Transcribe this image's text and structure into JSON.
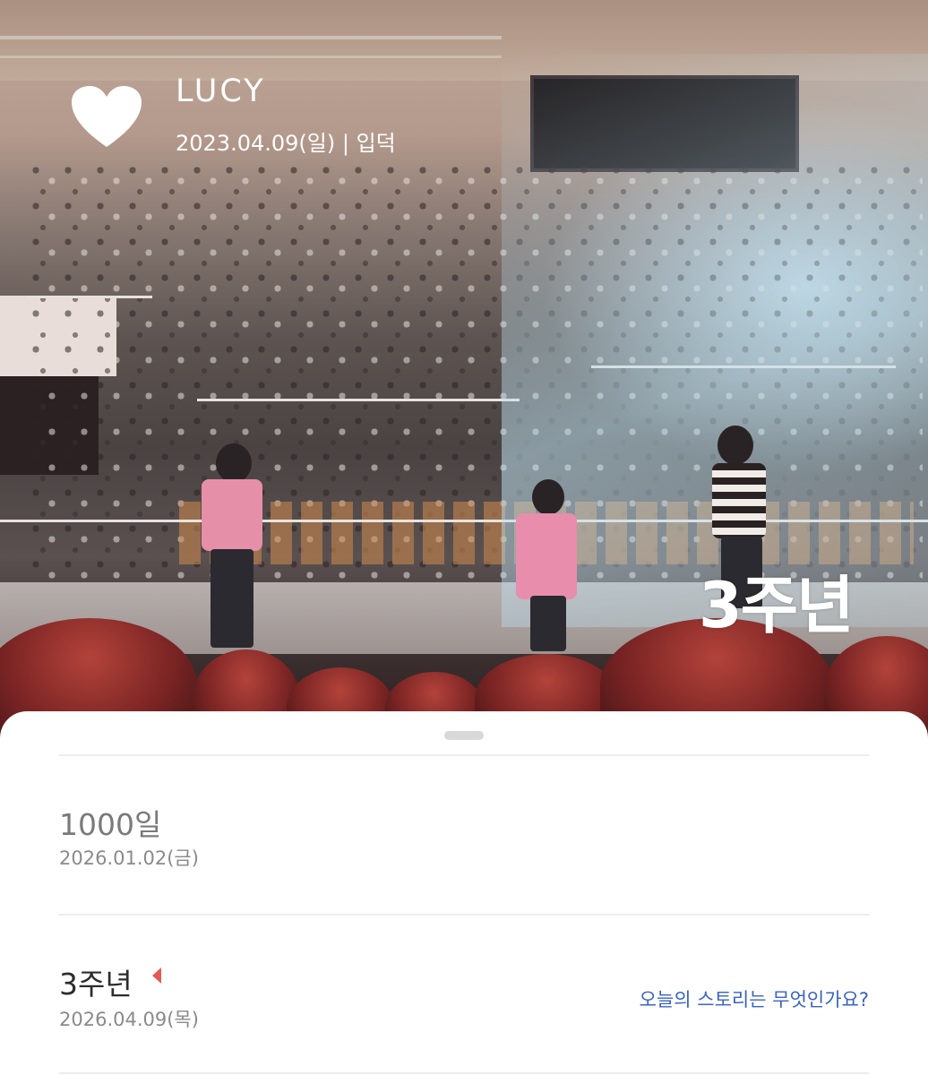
{
  "header": {
    "title": "LUCY",
    "subtitle": "2023.04.09(일)  |  입덕",
    "sticker_text": "3주년",
    "heart_icon": "heart-icon"
  },
  "entries": [
    {
      "title": "1000일",
      "date": "2026.01.02(금)",
      "active": false
    },
    {
      "title": "3주년",
      "date": "2026.04.09(목)",
      "active": true,
      "marker_icon": "triangle-marker-icon",
      "marker_color": "#e25a56",
      "action_label": "오늘의 스토리는 무엇인가요?"
    }
  ],
  "colors": {
    "link": "#3a62c4",
    "marker": "#e25a56",
    "muted_text": "#7a7a7a"
  }
}
